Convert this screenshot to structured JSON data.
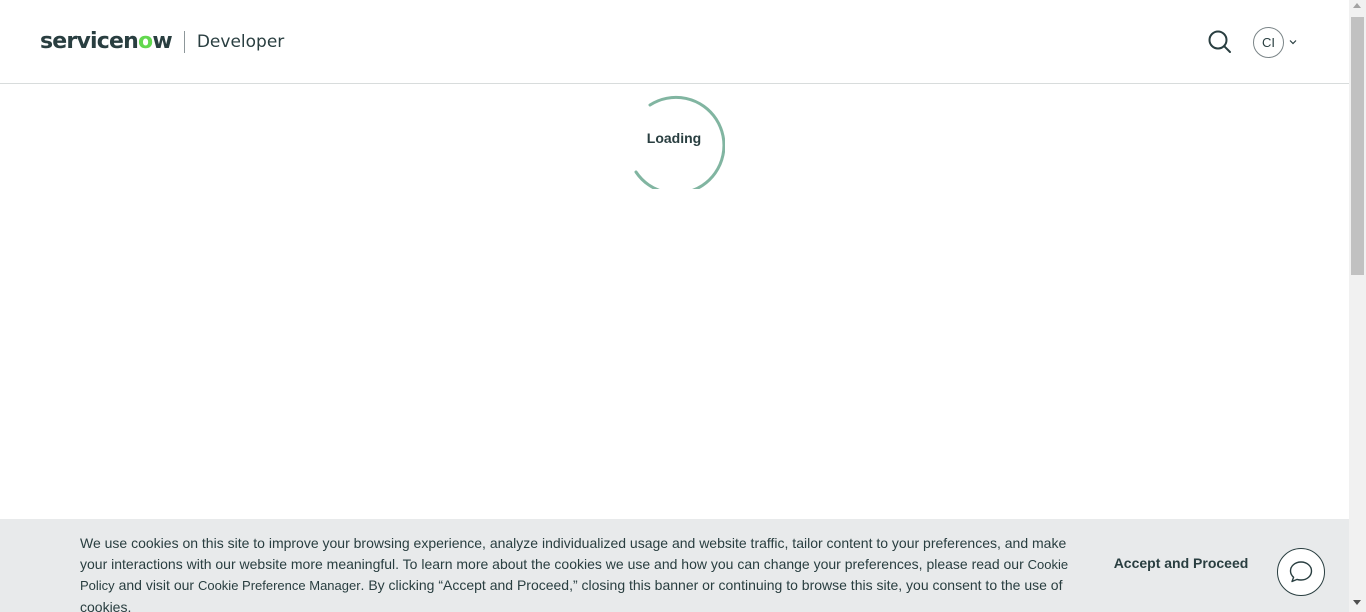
{
  "header": {
    "logo_text_a": "servicen",
    "logo_text_o": "o",
    "logo_text_b": "w",
    "product_name": "Developer",
    "user_initials": "CI"
  },
  "loader": {
    "label": "Loading"
  },
  "cookie_banner": {
    "text_1": "We use cookies on this site to improve your browsing experience, analyze individualized usage and website traffic, tailor content to your preferences, and make your interactions with our website more meaningful. To learn more about the cookies we use and how you can change your preferences, please read our ",
    "cookie_policy_link": "Cookie Policy",
    "text_2": " and visit our ",
    "cookie_preference_link": "Cookie Preference Manager",
    "text_3": ". By clicking “Accept and Proceed,” closing this banner or continuing to browse this site, you consent to the use of cookies.",
    "accept_label": "Accept and Proceed"
  },
  "colors": {
    "brand_dark": "#293e40",
    "brand_green": "#62d84e",
    "loader_ring": "#81b5a1",
    "banner_bg": "#e8eaeb"
  },
  "icons": {
    "search": "search-icon",
    "chevron": "chevron-down-icon",
    "chat": "chat-bubble-icon"
  }
}
